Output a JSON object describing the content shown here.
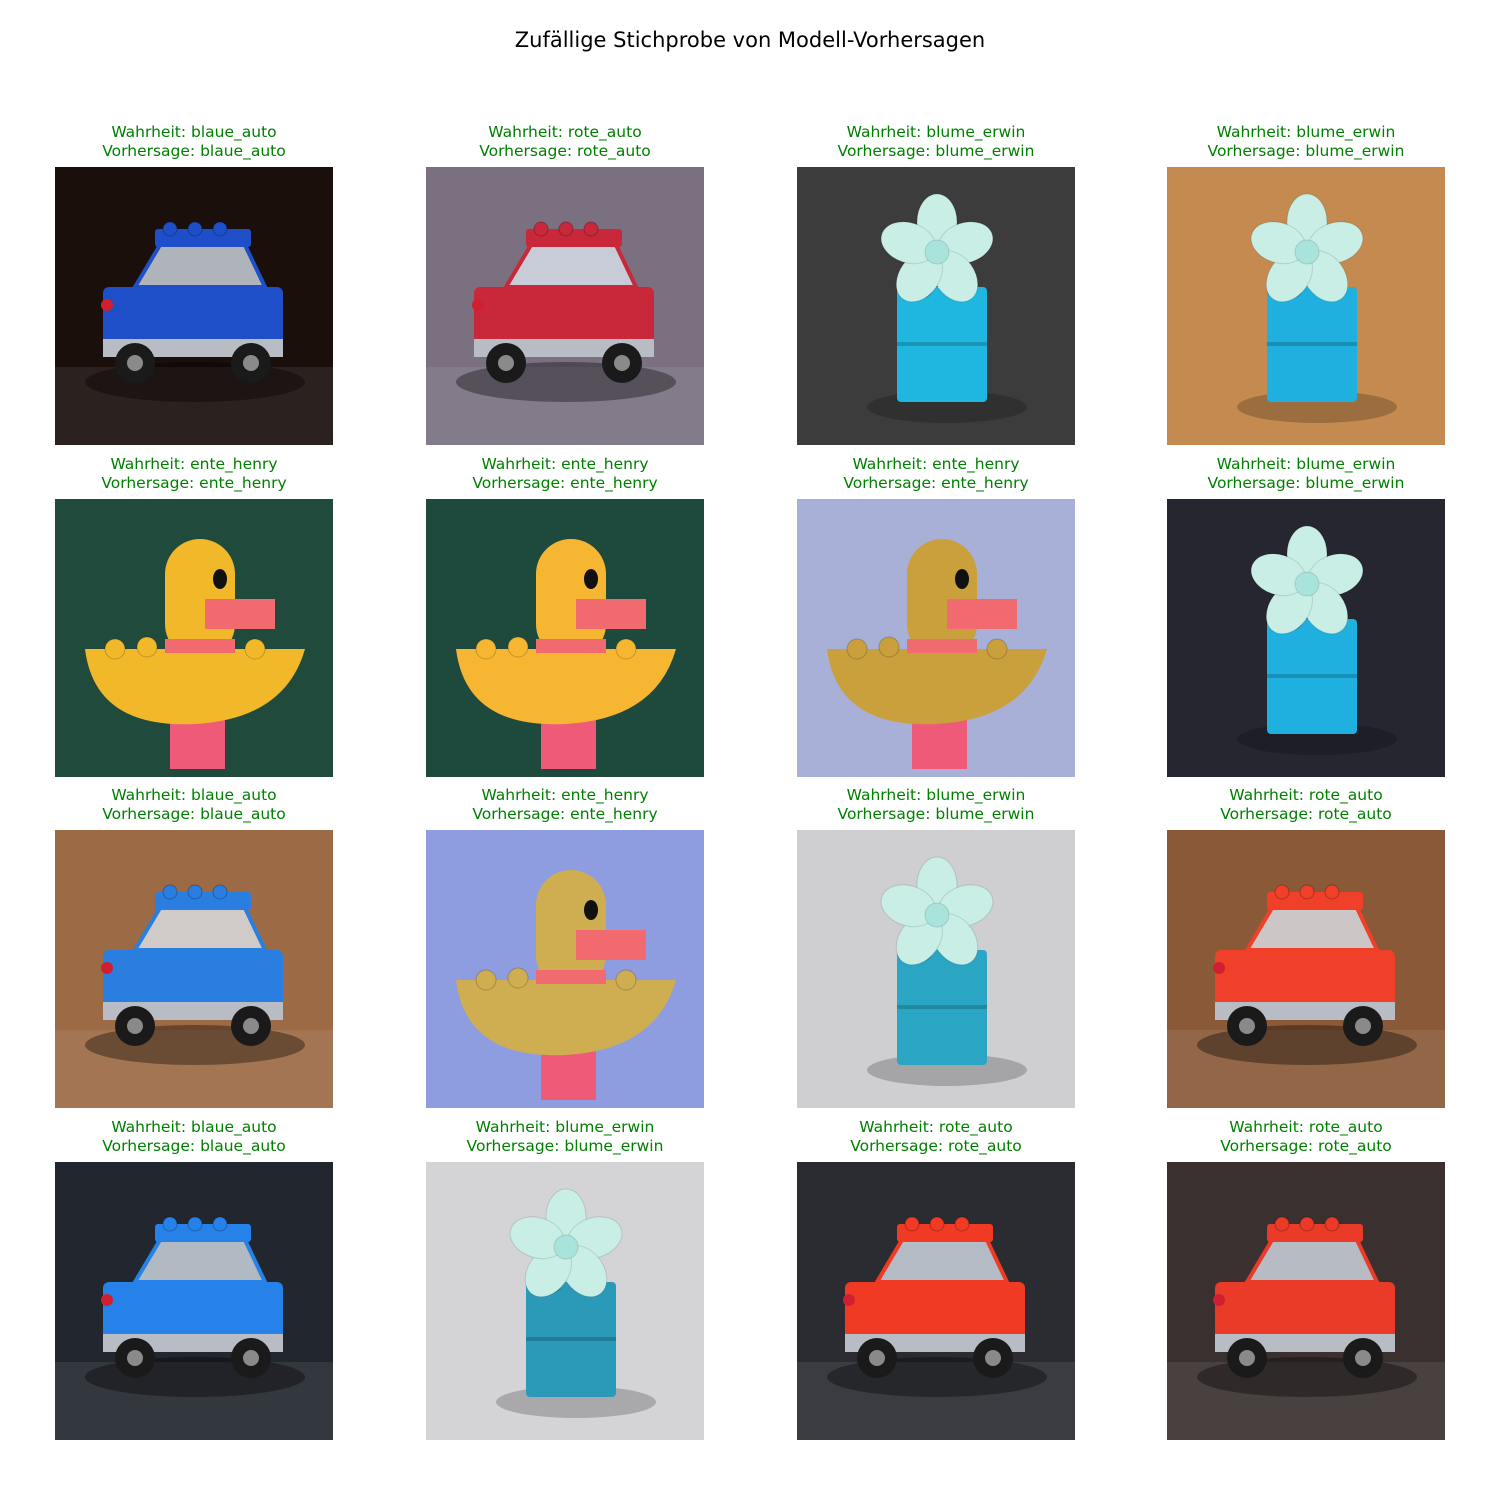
{
  "title": "Zufällige Stichprobe von Modell-Vorhersagen",
  "colors": {
    "correct": "#008000"
  },
  "samples": [
    {
      "truth": "Wahrheit: blaue_auto",
      "pred": "Vorhersage: blaue_auto",
      "subject": "car",
      "toy_color": "#1e4fc8",
      "bg": "#1a0f0b"
    },
    {
      "truth": "Wahrheit: rote_auto",
      "pred": "Vorhersage: rote_auto",
      "subject": "car",
      "toy_color": "#c8283a",
      "bg": "#7a7080"
    },
    {
      "truth": "Wahrheit: blume_erwin",
      "pred": "Vorhersage: blume_erwin",
      "subject": "flower",
      "toy_color": "#1fb6e0",
      "bg": "#3c3c3c"
    },
    {
      "truth": "Wahrheit: blume_erwin",
      "pred": "Vorhersage: blume_erwin",
      "subject": "flower",
      "toy_color": "#20b0e0",
      "bg": "#c48a4f"
    },
    {
      "truth": "Wahrheit: ente_henry",
      "pred": "Vorhersage: ente_henry",
      "subject": "duck",
      "toy_color": "#f1b92a",
      "bg": "#1f4a3c"
    },
    {
      "truth": "Wahrheit: ente_henry",
      "pred": "Vorhersage: ente_henry",
      "subject": "duck",
      "toy_color": "#f7b632",
      "bg": "#1e4a3e"
    },
    {
      "truth": "Wahrheit: ente_henry",
      "pred": "Vorhersage: ente_henry",
      "subject": "duck",
      "toy_color": "#c9a03c",
      "bg": "#a9b0d8"
    },
    {
      "truth": "Wahrheit: blume_erwin",
      "pred": "Vorhersage: blume_erwin",
      "subject": "flower",
      "toy_color": "#1fb0e0",
      "bg": "#252630"
    },
    {
      "truth": "Wahrheit: blaue_auto",
      "pred": "Vorhersage: blaue_auto",
      "subject": "car",
      "toy_color": "#2a7ee0",
      "bg": "#9c6a44"
    },
    {
      "truth": "Wahrheit: ente_henry",
      "pred": "Vorhersage: ente_henry",
      "subject": "duck",
      "toy_color": "#cfae52",
      "bg": "#8e9ce0"
    },
    {
      "truth": "Wahrheit: blume_erwin",
      "pred": "Vorhersage: blume_erwin",
      "subject": "flower",
      "toy_color": "#2aa6c4",
      "bg": "#cfcfd2"
    },
    {
      "truth": "Wahrheit: rote_auto",
      "pred": "Vorhersage: rote_auto",
      "subject": "car",
      "toy_color": "#f0402a",
      "bg": "#8a5a38"
    },
    {
      "truth": "Wahrheit: blaue_auto",
      "pred": "Vorhersage: blaue_auto",
      "subject": "car",
      "toy_color": "#2682e8",
      "bg": "#22262e"
    },
    {
      "truth": "Wahrheit: blume_erwin",
      "pred": "Vorhersage: blume_erwin",
      "subject": "flower",
      "toy_color": "#2a9ab8",
      "bg": "#d4d4d6"
    },
    {
      "truth": "Wahrheit: rote_auto",
      "pred": "Vorhersage: rote_auto",
      "subject": "car",
      "toy_color": "#f03a24",
      "bg": "#2a2c32"
    },
    {
      "truth": "Wahrheit: rote_auto",
      "pred": "Vorhersage: rote_auto",
      "subject": "car",
      "toy_color": "#ea3a28",
      "bg": "#3a3030"
    }
  ]
}
